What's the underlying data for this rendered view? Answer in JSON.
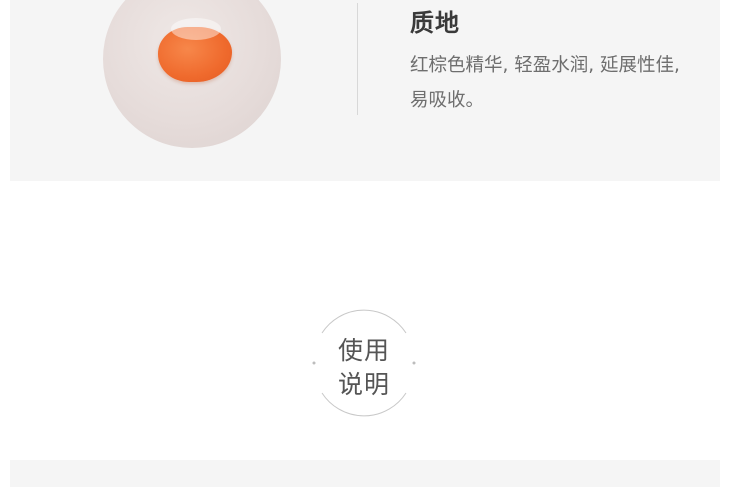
{
  "texture": {
    "title": "质地",
    "description": "红棕色精华, 轻盈水润, 延展性佳, 易吸收。",
    "swatch_color": "#ef6a2d"
  },
  "usage": {
    "line1": "使用",
    "line2": "说明"
  }
}
